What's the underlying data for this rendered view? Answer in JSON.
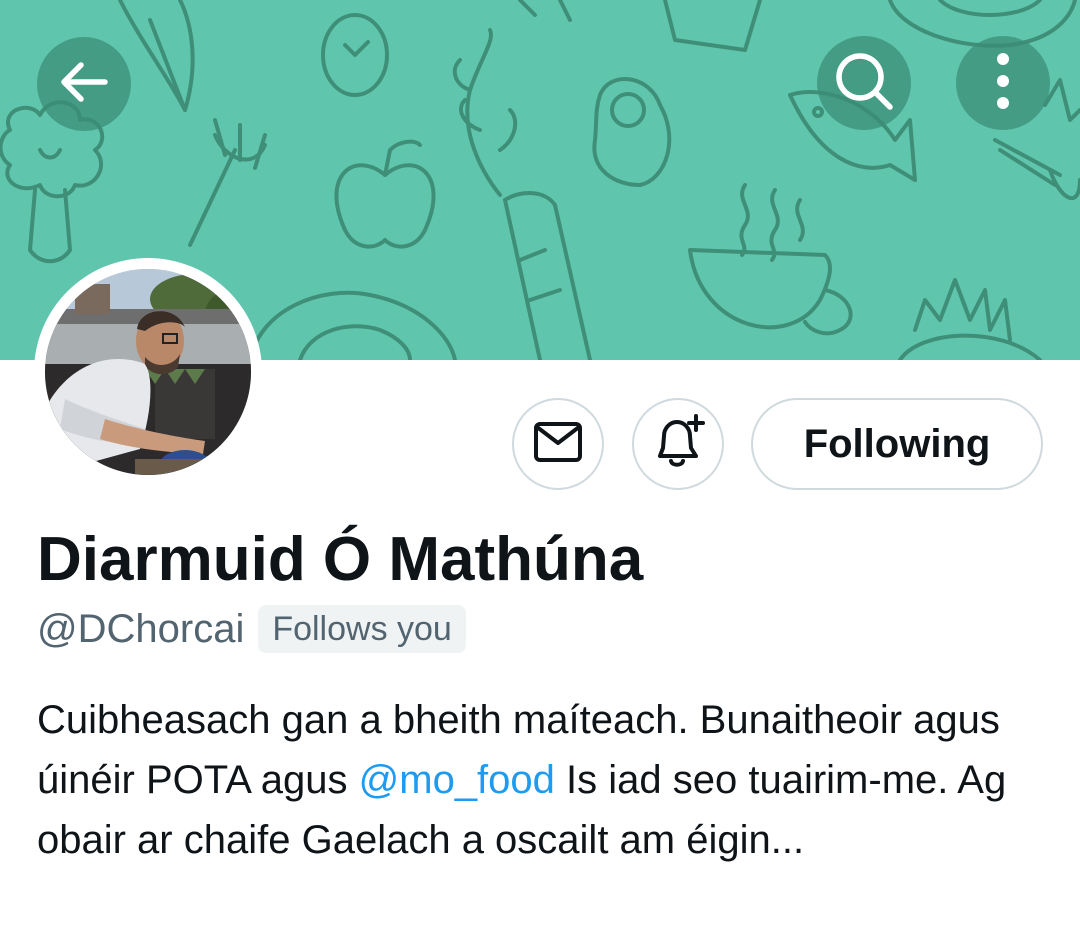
{
  "header": {
    "back_icon": "arrow-left-icon",
    "search_icon": "search-icon",
    "more_icon": "more-vertical-icon",
    "banner_color": "#5fc6ad"
  },
  "actions": {
    "message_icon": "envelope-icon",
    "notify_icon": "bell-plus-icon",
    "following_label": "Following"
  },
  "profile": {
    "display_name": "Diarmuid Ó Mathúna",
    "handle": "@DChorcai",
    "follows_you": "Follows you",
    "bio": {
      "part1": "Cuibheasach gan a bheith maíteach. Bunaitheoir agus úinéir POTA agus ",
      "mention": "@mo_food",
      "part2": " Is iad seo tuairim-me. Ag obair  ar chaife Gaelach a oscailt am éigin..."
    }
  },
  "colors": {
    "link": "#1d9bf0",
    "secondary_text": "#536471",
    "border": "#cfd9de"
  }
}
